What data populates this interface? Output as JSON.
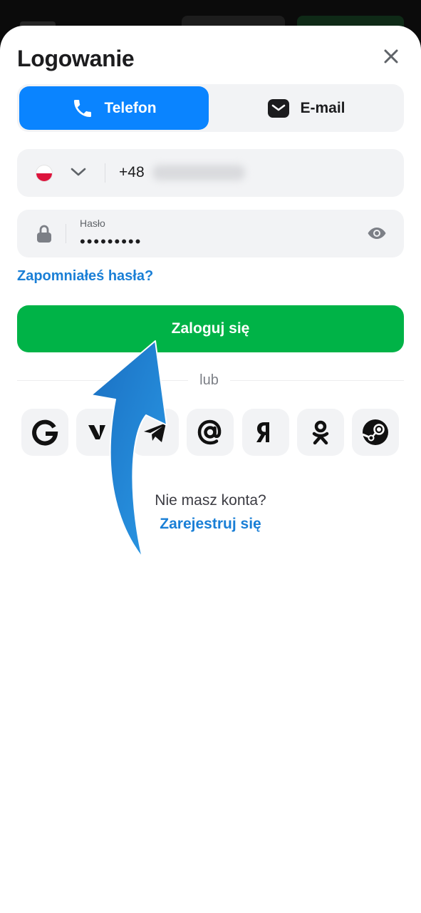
{
  "header": {
    "title": "Logowanie",
    "close_icon": "close-icon"
  },
  "tabs": [
    {
      "label": "Telefon",
      "icon": "phone-icon",
      "active": true
    },
    {
      "label": "E-mail",
      "icon": "mail-icon",
      "active": false
    }
  ],
  "phone": {
    "country": "Poland",
    "flag_colors": [
      "#ffffff",
      "#dc143c"
    ],
    "prefix": "+48"
  },
  "password": {
    "label": "Hasło",
    "value": "•••••••••",
    "icon": "lock-icon",
    "toggle_icon": "eye-icon"
  },
  "forgot_link": "Zapomniałeś hasła?",
  "login_button": "Zaloguj się",
  "divider_text": "lub",
  "social": [
    "google-icon",
    "vk-icon",
    "telegram-icon",
    "mail-ru-icon",
    "yandex-icon",
    "odnoklassniki-icon",
    "steam-icon"
  ],
  "footer": {
    "question": "Nie masz konta?",
    "register_link": "Zarejestruj się"
  },
  "colors": {
    "accent_blue": "#0a84ff",
    "link_blue": "#1a7fd6",
    "primary_green": "#00b347",
    "field_bg": "#f2f3f5",
    "text_dark": "#1c1c1e",
    "annotation_arrow": "#1e7ed0"
  }
}
